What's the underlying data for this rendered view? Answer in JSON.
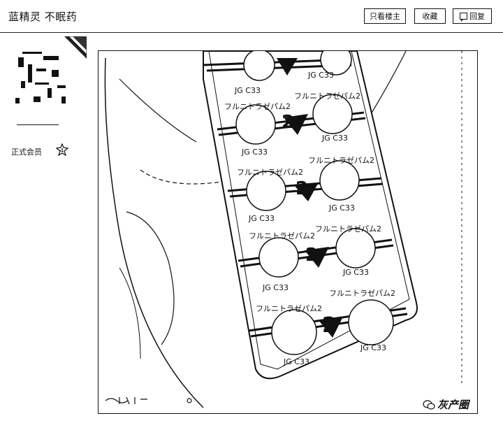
{
  "header": {
    "title": "蓝精灵 不眠药",
    "buttons": {
      "only_author": "只看楼主",
      "favorite": "收藏",
      "reply": "回复"
    }
  },
  "sidebar": {
    "member_level": "正式会员",
    "badge_icon": "level-badge-icon"
  },
  "post_image": {
    "blister_label": "フルニトラゼパム2",
    "pill_code": "JG C33",
    "strength_mark": "2",
    "watermark": "灰产圈"
  }
}
